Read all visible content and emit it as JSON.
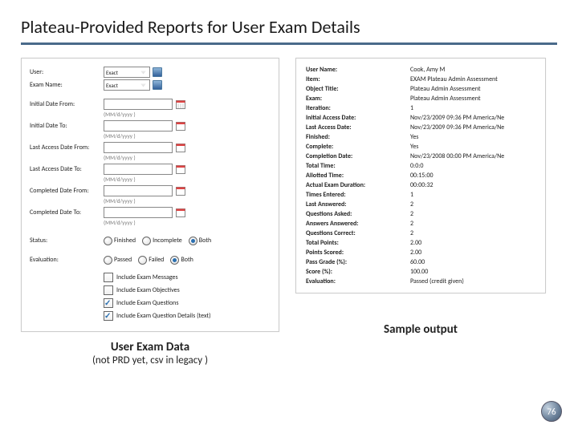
{
  "title": "Plateau-Provided Reports for User Exam Details",
  "page_number": "76",
  "left": {
    "caption_title": "User Exam Data",
    "caption_sub": "(not PRD yet, csv in legacy )",
    "date_hint": "(MM/d/yyyy )",
    "labels": {
      "user": "User:",
      "exam_name": "Exam Name:",
      "initial_from": "Initial Date From:",
      "initial_to": "Initial Date To:",
      "last_from": "Last Access Date From:",
      "last_to": "Last Access Date To:",
      "completed_from": "Completed Date From:",
      "completed_to": "Completed Date To:",
      "status": "Status:",
      "evaluation": "Evaluation:"
    },
    "selects": {
      "user": "Exact",
      "exam": "Exact"
    },
    "status_opts": {
      "finished": "Finished",
      "incomplete": "Incomplete",
      "both": "Both"
    },
    "eval_opts": {
      "passed": "Passed",
      "failed": "Failed",
      "both": "Both"
    },
    "checks": {
      "msgs": "Include Exam Messages",
      "objs": "Include Exam Objectives",
      "qs": "Include Exam Questions",
      "qd": "Include Exam Question Details (text)"
    }
  },
  "right": {
    "caption": "Sample output",
    "rows": [
      [
        "User Name:",
        "Cook, Amy M"
      ],
      [
        "Item:",
        "EXAM Plateau Admin Assessment"
      ],
      [
        "Object Title:",
        "Plateau Admin Assessment"
      ],
      [
        "Exam:",
        "Plateau Admin Assessment"
      ],
      [
        "Iteration:",
        "1"
      ],
      [
        "Initial Access Date:",
        "Nov/23/2009 09:36 PM America/Ne"
      ],
      [
        "Last Access Date:",
        "Nov/23/2009 09:36 PM America/Ne"
      ],
      [
        "Finished:",
        "Yes"
      ],
      [
        "Complete:",
        "Yes"
      ],
      [
        "Completion Date:",
        "Nov/23/2008 00:00 PM America/Ne"
      ],
      [
        "Total Time:",
        "0:0:0"
      ],
      [
        "Allotted Time:",
        "00:15:00"
      ],
      [
        "Actual Exam Duration:",
        "00:00:32"
      ],
      [
        "Times Entered:",
        "1"
      ],
      [
        "Last Answered:",
        "2"
      ],
      [
        "Questions Asked:",
        "2"
      ],
      [
        "Answers Answered:",
        "2"
      ],
      [
        "Questions Correct:",
        "2"
      ],
      [
        "Total Points:",
        "2.00"
      ],
      [
        "Points Scored:",
        "2.00"
      ],
      [
        "Pass Grade (%):",
        "60.00"
      ],
      [
        "Score (%):",
        "100.00"
      ],
      [
        "Evaluation:",
        "Passed (credit given)"
      ]
    ]
  }
}
